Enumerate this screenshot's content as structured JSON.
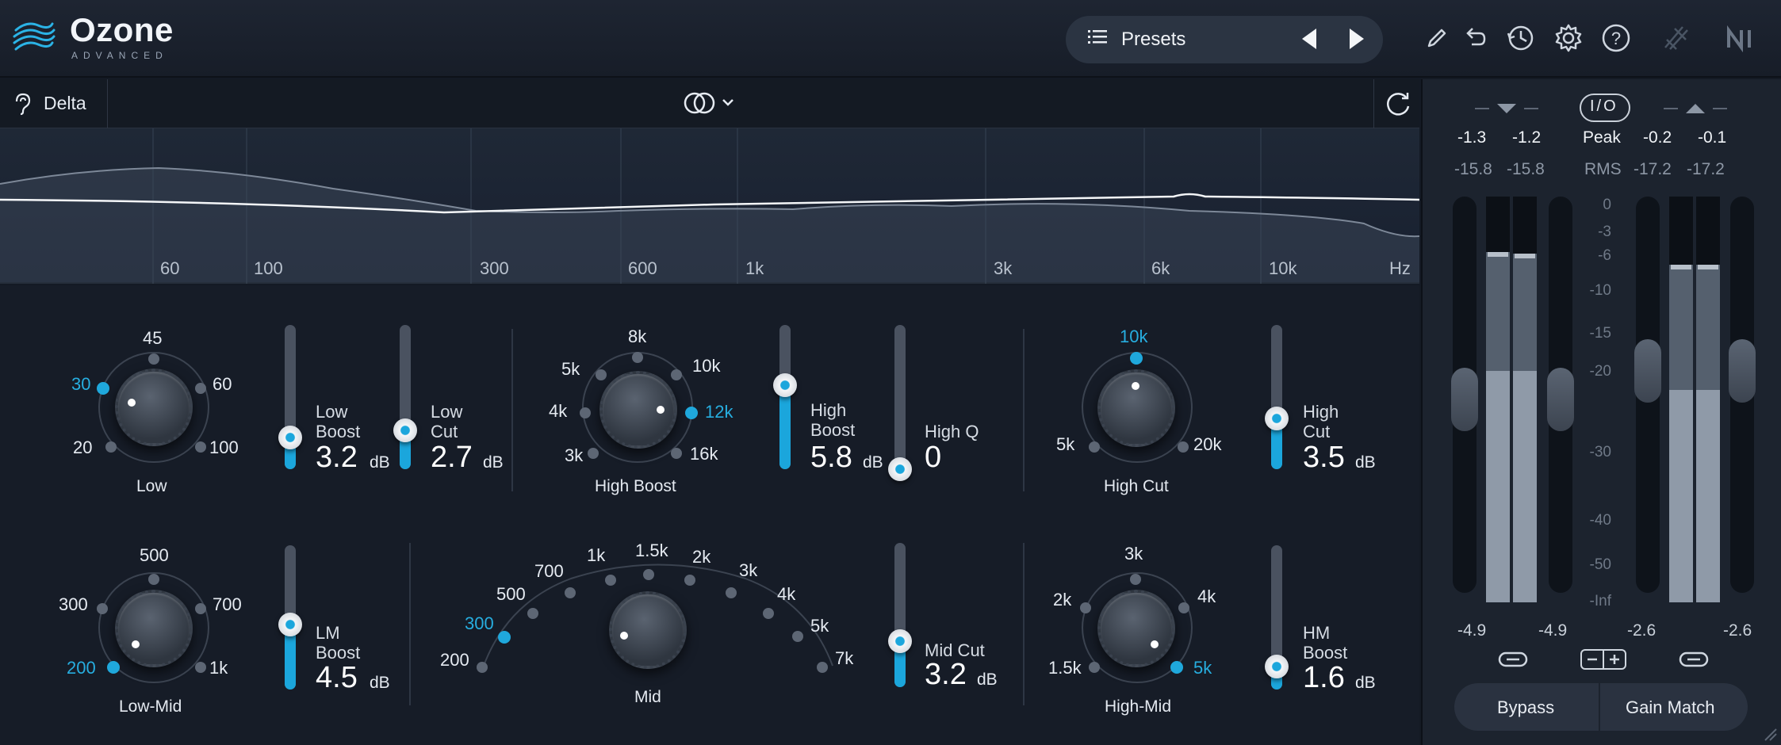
{
  "header": {
    "app_name": "Ozone",
    "app_subtitle": "ADVANCED",
    "presets_label": "Presets",
    "icons": [
      "list-icon",
      "prev-arrow-icon",
      "next-arrow-icon",
      "pencil-icon",
      "undo-icon",
      "history-icon",
      "gear-icon",
      "help-icon",
      "signal-chain-icon",
      "ni-logo-icon"
    ]
  },
  "toolbar": {
    "delta_label": "Delta",
    "stereo_icon": "stereo-mode-icon",
    "loop_icon": "refresh-icon"
  },
  "spectrum": {
    "freq_labels": [
      "60",
      "100",
      "300",
      "600",
      "1k",
      "3k",
      "6k",
      "10k",
      "Hz"
    ]
  },
  "low": {
    "label": "Low",
    "ticks": [
      "20",
      "30",
      "45",
      "60",
      "100"
    ],
    "selected": "30",
    "boost_name_1": "Low",
    "boost_name_2": "Boost",
    "boost_value": "3.2",
    "cut_name_1": "Low",
    "cut_name_2": "Cut",
    "cut_value": "2.7",
    "unit": "dB",
    "boost_level": 0.22,
    "cut_level": 0.27
  },
  "high_boost": {
    "label": "High Boost",
    "ticks": [
      "3k",
      "4k",
      "5k",
      "8k",
      "10k",
      "12k",
      "16k"
    ],
    "selected": "12k",
    "boost_name_1": "High",
    "boost_name_2": "Boost",
    "boost_value": "5.8",
    "q_name": "High Q",
    "q_value": "0",
    "unit": "dB",
    "boost_level": 0.58,
    "q_level": 0.0
  },
  "high_cut": {
    "label": "High Cut",
    "ticks": [
      "5k",
      "10k",
      "20k"
    ],
    "selected": "10k",
    "cut_name_1": "High",
    "cut_name_2": "Cut",
    "cut_value": "3.5",
    "unit": "dB",
    "cut_level": 0.35
  },
  "low_mid": {
    "label": "Low-Mid",
    "ticks": [
      "200",
      "300",
      "500",
      "700",
      "1k"
    ],
    "selected": "200",
    "boost_name_1": "LM",
    "boost_name_2": "Boost",
    "boost_value": "4.5",
    "unit": "dB",
    "boost_level": 0.45
  },
  "mid": {
    "label": "Mid",
    "ticks": [
      "200",
      "300",
      "500",
      "700",
      "1k",
      "1.5k",
      "2k",
      "3k",
      "4k",
      "5k",
      "7k"
    ],
    "selected": "300",
    "cut_name": "Mid Cut",
    "cut_value": "3.2",
    "unit": "dB",
    "cut_level": 0.32
  },
  "high_mid": {
    "label": "High-Mid",
    "ticks": [
      "1.5k",
      "2k",
      "3k",
      "4k",
      "5k"
    ],
    "selected": "5k",
    "boost_name_1": "HM",
    "boost_name_2": "Boost",
    "boost_value": "1.6",
    "unit": "dB",
    "boost_level": 0.16
  },
  "meters": {
    "io_label": "I/O",
    "in_peak_l": "-1.3",
    "in_peak_r": "-1.2",
    "out_peak_l": "-0.2",
    "out_peak_r": "-0.1",
    "peak_label": "Peak",
    "in_rms_l": "-15.8",
    "in_rms_r": "-15.8",
    "out_rms_l": "-17.2",
    "out_rms_r": "-17.2",
    "rms_label": "RMS",
    "scale": [
      "0",
      "-3",
      "-6",
      "-10",
      "-15",
      "-20",
      "-30",
      "-40",
      "-50",
      "-Inf"
    ],
    "in_gain_l": "-4.9",
    "in_gain_r": "-4.9",
    "out_gain_l": "-2.6",
    "out_gain_r": "-2.6",
    "bypass_label": "Bypass",
    "gain_match_label": "Gain Match"
  },
  "colors": {
    "accent": "#1ba6dc",
    "background": "#161c27",
    "panel": "#1c232e"
  }
}
